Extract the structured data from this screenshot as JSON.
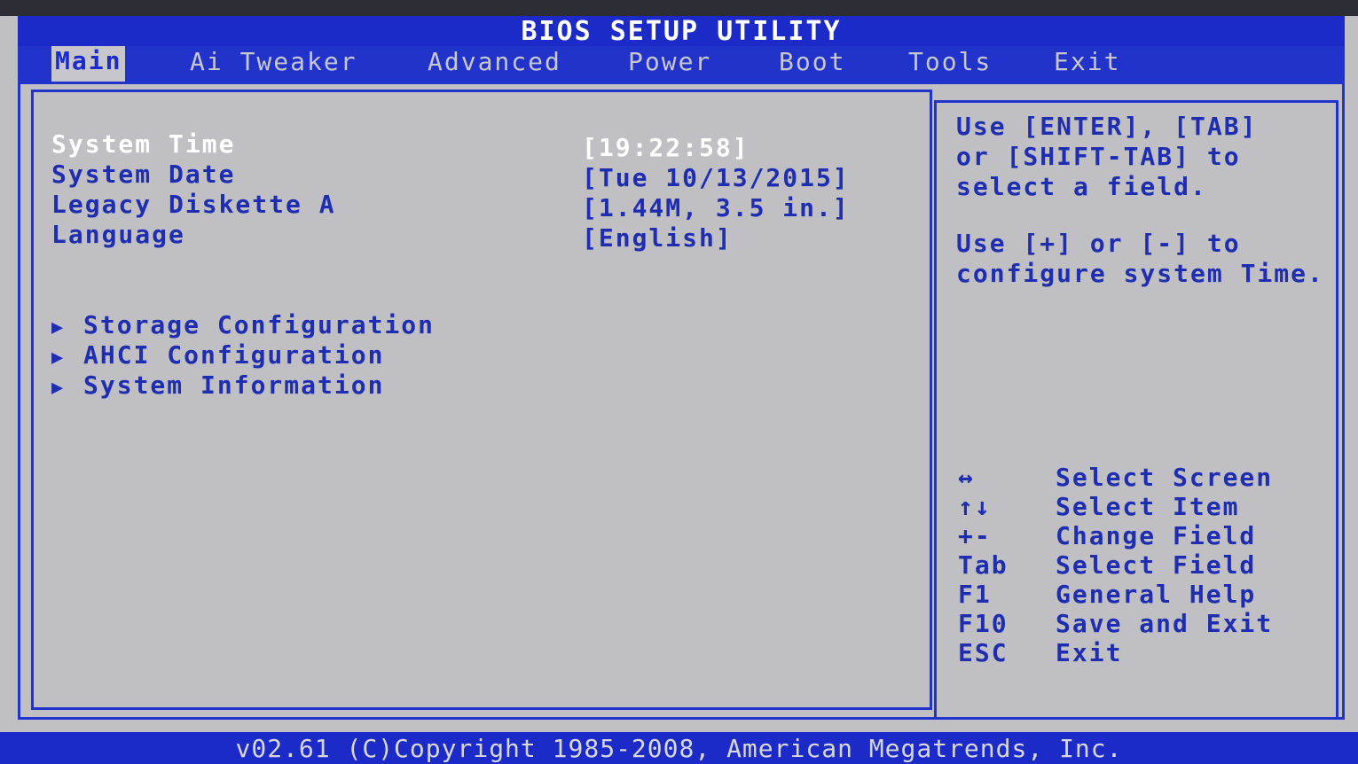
{
  "title": "BIOS SETUP UTILITY",
  "menu": {
    "tabs": [
      {
        "label": "Main"
      },
      {
        "label": "Ai Tweaker"
      },
      {
        "label": "Advanced"
      },
      {
        "label": "Power"
      },
      {
        "label": "Boot"
      },
      {
        "label": "Tools"
      },
      {
        "label": "Exit"
      }
    ],
    "active_tab": "Main"
  },
  "main": {
    "settings": [
      {
        "label": "System Time",
        "value": "[19:22:58]"
      },
      {
        "label": "System Date",
        "value": "[Tue 10/13/2015]"
      },
      {
        "label": "Legacy Diskette A",
        "value": "[1.44M, 3.5 in.]"
      },
      {
        "label": "Language",
        "value": "[English]"
      }
    ],
    "submenus": [
      {
        "label": "Storage Configuration"
      },
      {
        "label": "AHCI Configuration"
      },
      {
        "label": "System Information"
      }
    ],
    "submenu_arrow": "▶"
  },
  "help": {
    "lines": [
      "Use [ENTER], [TAB]",
      "or [SHIFT-TAB] to",
      "select a field.",
      "Use [+] or [-] to",
      "configure system Time."
    ]
  },
  "keys": [
    {
      "key": "↔",
      "action": "Select Screen"
    },
    {
      "key": "↑↓",
      "action": "Select Item"
    },
    {
      "key": "+-",
      "action": "Change Field"
    },
    {
      "key": "Tab",
      "action": "Select Field"
    },
    {
      "key": "F1",
      "action": "General Help"
    },
    {
      "key": "F10",
      "action": "Save and Exit"
    },
    {
      "key": "ESC",
      "action": "Exit"
    }
  ],
  "footer": "v02.61 (C)Copyright 1985-2008, American Megatrends, Inc.",
  "colors": {
    "bar_blue": "#1c2ac8",
    "background_gray": "#bfbfc4",
    "text_blue": "#1f2db0",
    "selected_white": "#ffffff"
  }
}
